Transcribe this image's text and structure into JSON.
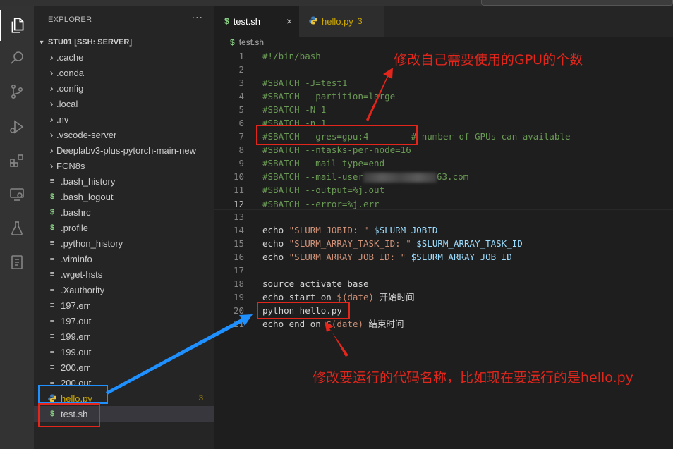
{
  "explorer": {
    "title": "EXPLORER",
    "more": "···",
    "root_label": "STU01 [SSH: SERVER]",
    "items": [
      {
        "label": ".cache",
        "kind": "folder"
      },
      {
        "label": ".conda",
        "kind": "folder"
      },
      {
        "label": ".config",
        "kind": "folder"
      },
      {
        "label": ".local",
        "kind": "folder"
      },
      {
        "label": ".nv",
        "kind": "folder"
      },
      {
        "label": ".vscode-server",
        "kind": "folder"
      },
      {
        "label": "Deeplabv3-plus-pytorch-main-new",
        "kind": "folder"
      },
      {
        "label": "FCN8s",
        "kind": "folder"
      },
      {
        "label": ".bash_history",
        "kind": "text"
      },
      {
        "label": ".bash_logout",
        "kind": "shell"
      },
      {
        "label": ".bashrc",
        "kind": "shell"
      },
      {
        "label": ".profile",
        "kind": "shell"
      },
      {
        "label": ".python_history",
        "kind": "text"
      },
      {
        "label": ".viminfo",
        "kind": "text"
      },
      {
        "label": ".wget-hsts",
        "kind": "text"
      },
      {
        "label": ".Xauthority",
        "kind": "text"
      },
      {
        "label": "197.err",
        "kind": "text"
      },
      {
        "label": "197.out",
        "kind": "text"
      },
      {
        "label": "199.err",
        "kind": "text"
      },
      {
        "label": "199.out",
        "kind": "text"
      },
      {
        "label": "200.err",
        "kind": "text"
      },
      {
        "label": "200.out",
        "kind": "text"
      },
      {
        "label": "hello.py",
        "kind": "python",
        "badge": "3"
      },
      {
        "label": "test.sh",
        "kind": "shell",
        "selected": true
      }
    ]
  },
  "tabs": [
    {
      "label": "test.sh",
      "icon": "$",
      "active": true,
      "close": "×"
    },
    {
      "label": "hello.py",
      "icon": "python-icon",
      "badge": "3"
    }
  ],
  "breadcrumb": {
    "icon": "$",
    "label": "test.sh"
  },
  "editor": {
    "current_line": 12,
    "lines": [
      {
        "n": "1",
        "segs": [
          {
            "t": "#!/bin/bash",
            "c": "c-com"
          }
        ]
      },
      {
        "n": "2",
        "segs": []
      },
      {
        "n": "3",
        "segs": [
          {
            "t": "#SBATCH -J=test1",
            "c": "c-com"
          }
        ]
      },
      {
        "n": "4",
        "segs": [
          {
            "t": "#SBATCH --partition=large",
            "c": "c-com"
          }
        ]
      },
      {
        "n": "5",
        "segs": [
          {
            "t": "#SBATCH -N 1",
            "c": "c-com"
          }
        ]
      },
      {
        "n": "6",
        "segs": [
          {
            "t": "#SBATCH -n 1",
            "c": "c-com"
          }
        ]
      },
      {
        "n": "7",
        "segs": [
          {
            "t": "#SBATCH --gres=gpu:4        # number of GPUs can available",
            "c": "c-com"
          }
        ]
      },
      {
        "n": "8",
        "segs": [
          {
            "t": "#SBATCH --ntasks-per-node=16",
            "c": "c-com"
          }
        ]
      },
      {
        "n": "9",
        "segs": [
          {
            "t": "#SBATCH --mail-type=end",
            "c": "c-com"
          }
        ]
      },
      {
        "n": "10",
        "segs": [
          {
            "t": "#SBATCH --mail-user",
            "c": "c-com"
          },
          {
            "blur": true
          },
          {
            "t": "63.com",
            "c": "c-com"
          }
        ]
      },
      {
        "n": "11",
        "segs": [
          {
            "t": "#SBATCH --output=%j.out",
            "c": "c-com"
          }
        ]
      },
      {
        "n": "12",
        "segs": [
          {
            "t": "#SBATCH --error=%j.err",
            "c": "c-com"
          }
        ]
      },
      {
        "n": "13",
        "segs": []
      },
      {
        "n": "14",
        "segs": [
          {
            "t": "echo ",
            "c": "c-kw"
          },
          {
            "t": "\"SLURM_JOBID: \"",
            "c": "c-str"
          },
          {
            "t": " $SLURM_JOBID",
            "c": "c-var"
          }
        ]
      },
      {
        "n": "15",
        "segs": [
          {
            "t": "echo ",
            "c": "c-kw"
          },
          {
            "t": "\"SLURM_ARRAY_TASK_ID: \"",
            "c": "c-str"
          },
          {
            "t": " $SLURM_ARRAY_TASK_ID",
            "c": "c-var"
          }
        ]
      },
      {
        "n": "16",
        "segs": [
          {
            "t": "echo ",
            "c": "c-kw"
          },
          {
            "t": "\"SLURM_ARRAY_JOB_ID: \"",
            "c": "c-str"
          },
          {
            "t": " $SLURM_ARRAY_JOB_ID",
            "c": "c-var"
          }
        ]
      },
      {
        "n": "17",
        "segs": []
      },
      {
        "n": "18",
        "segs": [
          {
            "t": "source activate base",
            "c": "c-kw"
          }
        ]
      },
      {
        "n": "19",
        "segs": [
          {
            "t": "echo start on ",
            "c": "c-kw"
          },
          {
            "t": "$(date)",
            "c": "c-sub"
          },
          {
            "t": " 开始时间",
            "c": "c-kw"
          }
        ]
      },
      {
        "n": "20",
        "segs": [
          {
            "t": "python hello.py",
            "c": "c-kw"
          }
        ]
      },
      {
        "n": "21",
        "segs": [
          {
            "t": "echo end on ",
            "c": "c-kw"
          },
          {
            "t": "$(date)",
            "c": "c-sub"
          },
          {
            "t": " 结束时间",
            "c": "c-kw"
          }
        ]
      }
    ]
  },
  "annotations": {
    "gpu_note": "修改自己需要使用的GPU的个数",
    "run_note": "修改要运行的代码名称，比如现在要运行的是hello.py"
  },
  "colors": {
    "annotation_red": "#e2261c",
    "annotation_blue": "#1e90ff",
    "comment_green": "#6a9955",
    "string_orange": "#ce9178",
    "variable_blue": "#9cdcfe",
    "modified_yellow": "#cca700"
  }
}
